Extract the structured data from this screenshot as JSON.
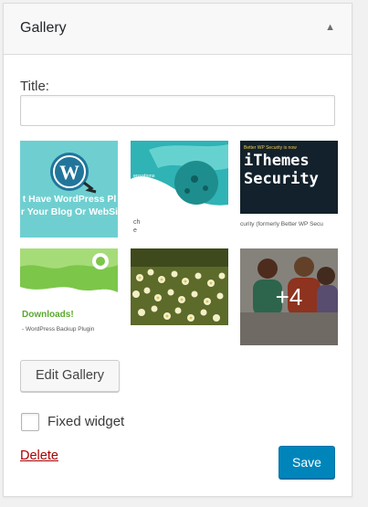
{
  "widget": {
    "title": "Gallery",
    "toggle_icon": "triangle-up"
  },
  "form": {
    "title_label": "Title:",
    "title_value": ""
  },
  "gallery": {
    "items": [
      {
        "caption_main": "t Have WordPress Pl",
        "caption_sub": "r Your Blog Or WebSi",
        "icon": "wordpress-logo",
        "bg": "#6fcfd0"
      },
      {
        "text_top": "ch",
        "text_bottom": "e",
        "small_label": "ensations",
        "bg": "#2fb3b5"
      },
      {
        "small_label": "Better WP Security is now",
        "title_line1": "iThemes",
        "title_line2": "Security",
        "caption": "curity (formerly Better WP Secu",
        "bg": "#12212b"
      },
      {
        "heading": "Downloads!",
        "caption": "- WordPress Backup Plugin",
        "bg": "#7cc64a"
      },
      {
        "icon": "flowers-photo",
        "bg": "#5c6a2a"
      },
      {
        "more_label": "+4",
        "icon": "people-photo",
        "bg": "#a7a39b"
      }
    ]
  },
  "buttons": {
    "edit_gallery": "Edit Gallery",
    "save": "Save"
  },
  "options": {
    "fixed_widget_label": "Fixed widget",
    "fixed_widget_checked": false
  },
  "links": {
    "delete": "Delete"
  },
  "colors": {
    "primary": "#0085ba",
    "delete": "#a00000"
  }
}
